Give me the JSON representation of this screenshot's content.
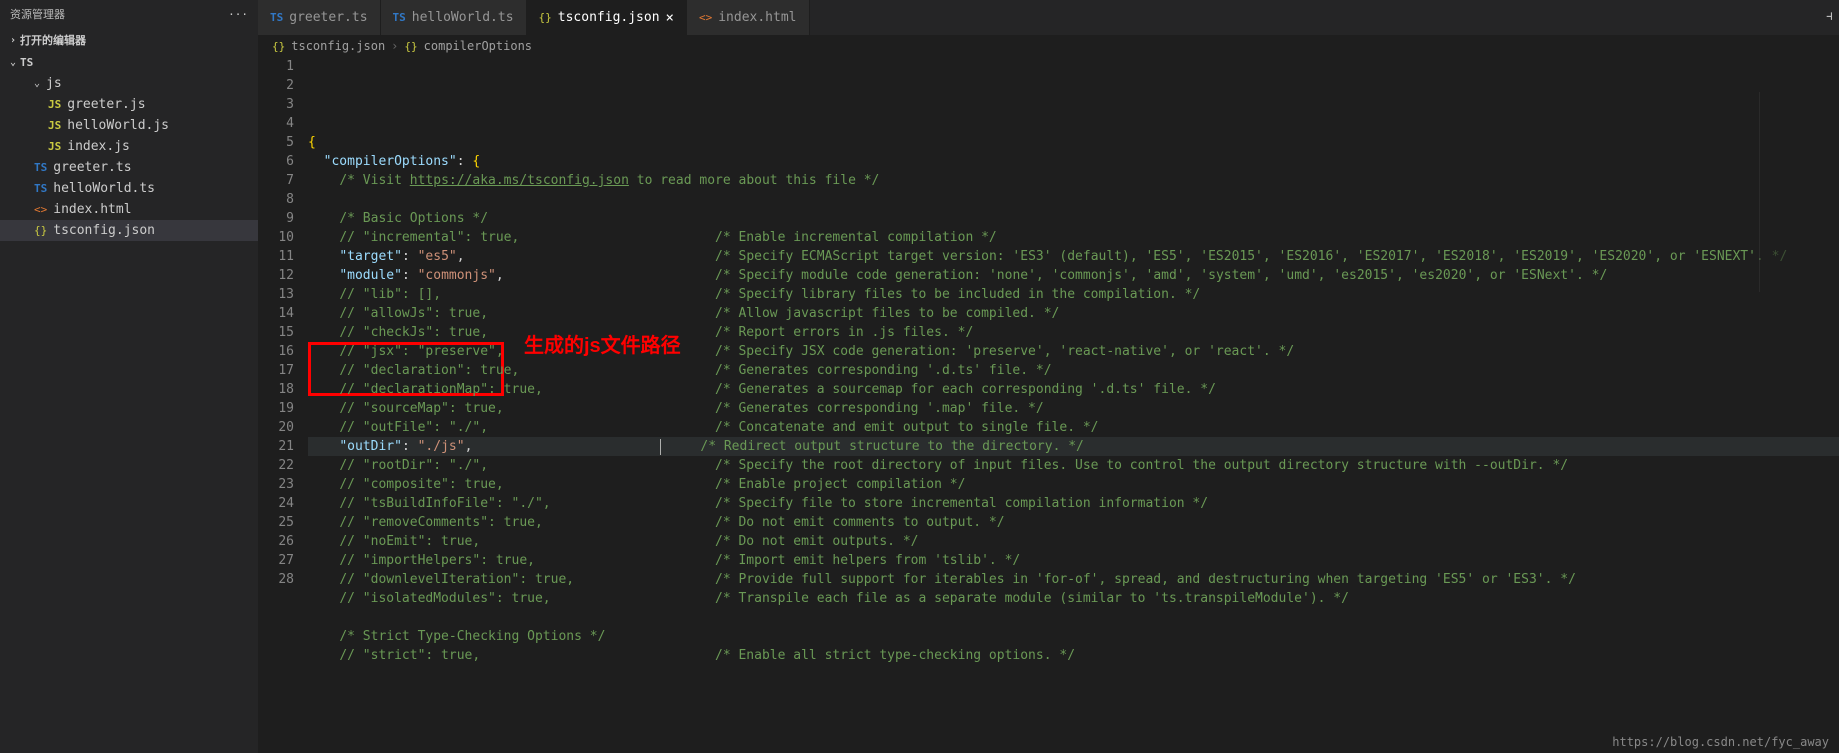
{
  "sidebar": {
    "title": "资源管理器",
    "more": "···",
    "section_open": "打开的编辑器",
    "section_ts": "TS",
    "folder_js": "js",
    "items": [
      {
        "icon": "JS",
        "label": "greeter.js",
        "cls": "ico-js",
        "indent": 2
      },
      {
        "icon": "JS",
        "label": "helloWorld.js",
        "cls": "ico-js",
        "indent": 2
      },
      {
        "icon": "JS",
        "label": "index.js",
        "cls": "ico-js",
        "indent": 2
      },
      {
        "icon": "TS",
        "label": "greeter.ts",
        "cls": "ico-ts",
        "indent": 1
      },
      {
        "icon": "TS",
        "label": "helloWorld.ts",
        "cls": "ico-ts",
        "indent": 1
      },
      {
        "icon": "<>",
        "label": "index.html",
        "cls": "ico-html",
        "indent": 1
      },
      {
        "icon": "{}",
        "label": "tsconfig.json",
        "cls": "ico-json",
        "indent": 1,
        "active": true
      }
    ]
  },
  "tabs": [
    {
      "icon": "TS",
      "label": "greeter.ts",
      "cls": "ico-ts"
    },
    {
      "icon": "TS",
      "label": "helloWorld.ts",
      "cls": "ico-ts"
    },
    {
      "icon": "{}",
      "label": "tsconfig.json",
      "cls": "ico-json",
      "active": true,
      "close": "×"
    },
    {
      "icon": "<>",
      "label": "index.html",
      "cls": "ico-html"
    }
  ],
  "breadcrumb": {
    "p1_icon": "{}",
    "p1": "tsconfig.json",
    "sep": "›",
    "p2_icon": "{}",
    "p2": "compilerOptions"
  },
  "annotation": {
    "red_text": "生成的js文件路径"
  },
  "watermark": "https://blog.csdn.net/fyc_away",
  "code": {
    "lines": [
      {
        "n": 1,
        "html": "<span class='tok-brace'>{</span>"
      },
      {
        "n": 2,
        "html": "  <span class='tok-key'>\"compilerOptions\"</span><span class='tok-punc'>:</span> <span class='tok-brace'>{</span>"
      },
      {
        "n": 3,
        "html": "    <span class='tok-comment'>/* Visit </span><span class='tok-link'>https://aka.ms/tsconfig.json</span><span class='tok-comment'> to read more about this file */</span>"
      },
      {
        "n": 4,
        "html": ""
      },
      {
        "n": 5,
        "html": "    <span class='tok-comment'>/* Basic Options */</span>"
      },
      {
        "n": 6,
        "html": "    <span class='tok-comment'>// \"incremental\": true,                         /* Enable incremental compilation */</span>"
      },
      {
        "n": 7,
        "html": "    <span class='tok-key'>\"target\"</span><span class='tok-punc'>:</span> <span class='tok-str'>\"es5\"</span><span class='tok-punc'>,</span>                                <span class='tok-comment'>/* Specify ECMAScript target version: 'ES3' (default), 'ES5', 'ES2015', 'ES2016', 'ES2017', 'ES2018', 'ES2019', 'ES2020', or 'ESNEXT'. */</span>"
      },
      {
        "n": 8,
        "html": "    <span class='tok-key'>\"module\"</span><span class='tok-punc'>:</span> <span class='tok-str'>\"commonjs\"</span><span class='tok-punc'>,</span>                           <span class='tok-comment'>/* Specify module code generation: 'none', 'commonjs', 'amd', 'system', 'umd', 'es2015', 'es2020', or 'ESNext'. */</span>"
      },
      {
        "n": 9,
        "html": "    <span class='tok-comment'>// \"lib\": [],                                   /* Specify library files to be included in the compilation. */</span>"
      },
      {
        "n": 10,
        "html": "    <span class='tok-comment'>// \"allowJs\": true,                             /* Allow javascript files to be compiled. */</span>"
      },
      {
        "n": 11,
        "html": "    <span class='tok-comment'>// \"checkJs\": true,                             /* Report errors in .js files. */</span>"
      },
      {
        "n": 12,
        "html": "    <span class='tok-comment'>// \"jsx\": \"preserve\",                           /* Specify JSX code generation: 'preserve', 'react-native', or 'react'. */</span>"
      },
      {
        "n": 13,
        "html": "    <span class='tok-comment'>// \"declaration\": true,                         /* Generates corresponding '.d.ts' file. */</span>"
      },
      {
        "n": 14,
        "html": "    <span class='tok-comment'>// \"declarationMap\": true,                      /* Generates a sourcemap for each corresponding '.d.ts' file. */</span>"
      },
      {
        "n": 15,
        "html": "    <span class='tok-comment'>// \"sourceMap\": true,                           /* Generates corresponding '.map' file. */</span>"
      },
      {
        "n": 16,
        "html": "    <span class='tok-comment'>// \"outFile\": \"./\",                             /* Concatenate and emit output to single file. */</span>"
      },
      {
        "n": 17,
        "html": "    <span class='tok-key'>\"outDir\"</span><span class='tok-punc'>:</span> <span class='tok-str'>\"./js\"</span><span class='tok-punc'>,</span>                        <span class='cursor'></span>     <span class='tok-comment'>/* Redirect output structure to the directory. */</span>",
        "current": true
      },
      {
        "n": 18,
        "html": "    <span class='tok-comment'>// \"rootDir\": \"./\",                             /* Specify the root directory of input files. Use to control the output directory structure with --outDir. */</span>"
      },
      {
        "n": 19,
        "html": "    <span class='tok-comment'>// \"composite\": true,                           /* Enable project compilation */</span>"
      },
      {
        "n": 20,
        "html": "    <span class='tok-comment'>// \"tsBuildInfoFile\": \"./\",                     /* Specify file to store incremental compilation information */</span>"
      },
      {
        "n": 21,
        "html": "    <span class='tok-comment'>// \"removeComments\": true,                      /* Do not emit comments to output. */</span>"
      },
      {
        "n": 22,
        "html": "    <span class='tok-comment'>// \"noEmit\": true,                              /* Do not emit outputs. */</span>"
      },
      {
        "n": 23,
        "html": "    <span class='tok-comment'>// \"importHelpers\": true,                       /* Import emit helpers from 'tslib'. */</span>"
      },
      {
        "n": 24,
        "html": "    <span class='tok-comment'>// \"downlevelIteration\": true,                  /* Provide full support for iterables in 'for-of', spread, and destructuring when targeting 'ES5' or 'ES3'. */</span>"
      },
      {
        "n": 25,
        "html": "    <span class='tok-comment'>// \"isolatedModules\": true,                     /* Transpile each file as a separate module (similar to 'ts.transpileModule'). */</span>"
      },
      {
        "n": 26,
        "html": ""
      },
      {
        "n": 27,
        "html": "    <span class='tok-comment'>/* Strict Type-Checking Options */</span>"
      },
      {
        "n": 28,
        "html": "    <span class='tok-comment'>// \"strict\": true,                              /* Enable all strict type-checking options. */</span>"
      }
    ],
    "wrap_indent": "    "
  }
}
